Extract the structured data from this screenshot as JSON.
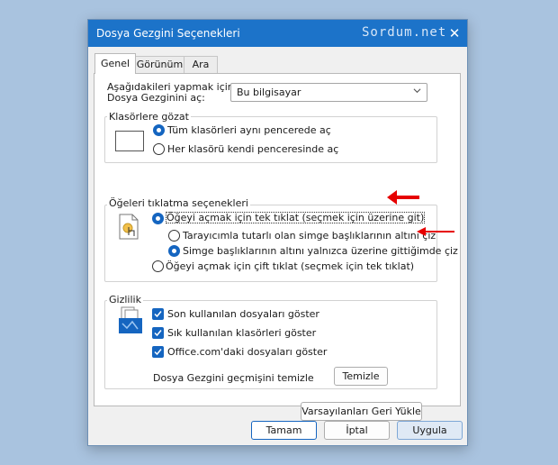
{
  "window": {
    "title": "Dosya Gezgini Seçenekleri",
    "watermark": "Sordum.net",
    "close_glyph": "✕"
  },
  "tabs": [
    {
      "label": "Genel",
      "active": true
    },
    {
      "label": "Görünüm",
      "active": false
    },
    {
      "label": "Ara",
      "active": false
    }
  ],
  "general": {
    "open_label_line1": "Aşağıdakileri yapmak için",
    "open_label_line2": "Dosya Gezginini aç:",
    "open_value": "Bu bilgisayar",
    "browse_group": {
      "title": "Klasörlere gözat",
      "option1": "Tüm klasörleri aynı pencerede aç",
      "option2": "Her klasörü kendi penceresinde aç",
      "selected": 1
    },
    "click_group": {
      "title": "Öğeleri tıklatma seçenekleri",
      "single": "Öğeyi açmak için tek tıklat (seçmek için üzerine git)",
      "sub1": "Tarayıcımla tutarlı olan simge başlıklarının altını çiz",
      "sub2": "Simge başlıklarının altını yalnızca üzerine gittiğimde çiz",
      "double": "Öğeyi açmak için çift tıklat (seçmek için tek tıklat)",
      "selected": "single",
      "sub_selected": "sub2"
    },
    "privacy_group": {
      "title": "Gizlilik",
      "check1": "Son kullanılan dosyaları göster",
      "check2": "Sık kullanılan klasörleri göster",
      "check3": "Office.com'daki dosyaları göster",
      "clear_label": "Dosya Gezgini geçmişini temizle",
      "clear_button": "Temizle"
    },
    "restore_button": "Varsayılanları Geri Yükle"
  },
  "footer": {
    "ok": "Tamam",
    "cancel": "İptal",
    "apply": "Uygula"
  },
  "colors": {
    "titlebar": "#1c73c9",
    "accent": "#1565c0",
    "arrow": "#e60000"
  }
}
